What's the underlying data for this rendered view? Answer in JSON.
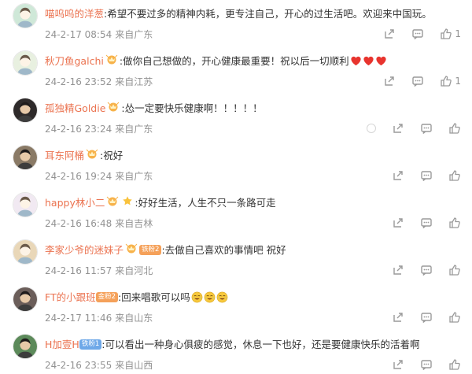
{
  "comments": [
    {
      "username": "喵呜呜的洋葱",
      "text": "希望不要过多的精神内耗，更专注自己，开心的过生活吧。欢迎来中国玩。",
      "timestamp": "24-2-17 08:54",
      "location": "来自广东",
      "likes": "1",
      "badges": [],
      "hearts": 0,
      "cry_emojis": 0,
      "report_icon": false,
      "avatar_color": "#cfe8d8"
    },
    {
      "username": "秋刀鱼galchi",
      "text": "做你自己想做的，开心健康最重要！祝以后一切顺利",
      "timestamp": "24-2-16 23:52",
      "location": "来自江苏",
      "likes": "1",
      "badges": [
        "crown-badge"
      ],
      "hearts": 3,
      "cry_emojis": 0,
      "report_icon": false,
      "avatar_color": "#e8f0e0"
    },
    {
      "username": "孤独精Goldie",
      "text": "怂一定要快乐健康啊！！！！！",
      "timestamp": "24-2-16 23:24",
      "location": "来自广东",
      "likes": "",
      "badges": [
        "crown-badge"
      ],
      "hearts": 0,
      "cry_emojis": 0,
      "report_icon": true,
      "avatar_color": "#2e2a2a"
    },
    {
      "username": "耳东阿桶",
      "text": "祝好",
      "timestamp": "24-2-16 19:24",
      "location": "来自广东",
      "likes": "",
      "badges": [
        "crown-badge"
      ],
      "hearts": 0,
      "cry_emojis": 0,
      "report_icon": false,
      "avatar_color": "#8a7a66"
    },
    {
      "username": "happy林小二",
      "text": "好好生活，人生不只一条路可走",
      "timestamp": "24-2-16 16:48",
      "location": "来自吉林",
      "likes": "",
      "badges": [
        "crown-badge",
        "star-badge"
      ],
      "hearts": 0,
      "cry_emojis": 0,
      "report_icon": false,
      "avatar_color": "#f1e9f2"
    },
    {
      "username": "李家少爷的迷妹子",
      "text": "去做自己喜欢的事情吧  祝好",
      "timestamp": "24-2-16 11:57",
      "location": "来自河北",
      "likes": "",
      "badges": [
        "crown-badge"
      ],
      "level_tag": "铁粉2",
      "level_color": "orange",
      "hearts": 0,
      "cry_emojis": 0,
      "report_icon": false,
      "avatar_color": "#e9d7b8"
    },
    {
      "username": "FT的小跟班",
      "text": "回来唱歌可以吗",
      "timestamp": "24-2-17 11:46",
      "location": "来自山东",
      "likes": "",
      "badges": [],
      "level_tag": "金粉2",
      "level_color": "orange",
      "hearts": 0,
      "cry_emojis": 3,
      "report_icon": false,
      "avatar_color": "#6b5e5a"
    },
    {
      "username": "H加壹H",
      "text": "可以看出一种身心俱疲的感觉，休息一下也好，还是要健康快乐的活着啊",
      "timestamp": "24-2-16 23:55",
      "location": "来自山西",
      "likes": "",
      "badges": [],
      "level_tag": "铁粉1",
      "level_color": "blue",
      "hearts": 0,
      "cry_emojis": 0,
      "report_icon": false,
      "avatar_color": "#5c8a5a"
    }
  ],
  "colon": ":",
  "icons": {
    "share": "share-icon",
    "comment": "comment-icon",
    "like": "thumbs-up-icon",
    "report": "report-icon",
    "heart": "red-heart-emoji",
    "cry": "crying-laughing-emoji"
  },
  "colors": {
    "username": "#eb7350",
    "meta": "#939393",
    "text": "#333333",
    "heart": "#e8342e"
  }
}
